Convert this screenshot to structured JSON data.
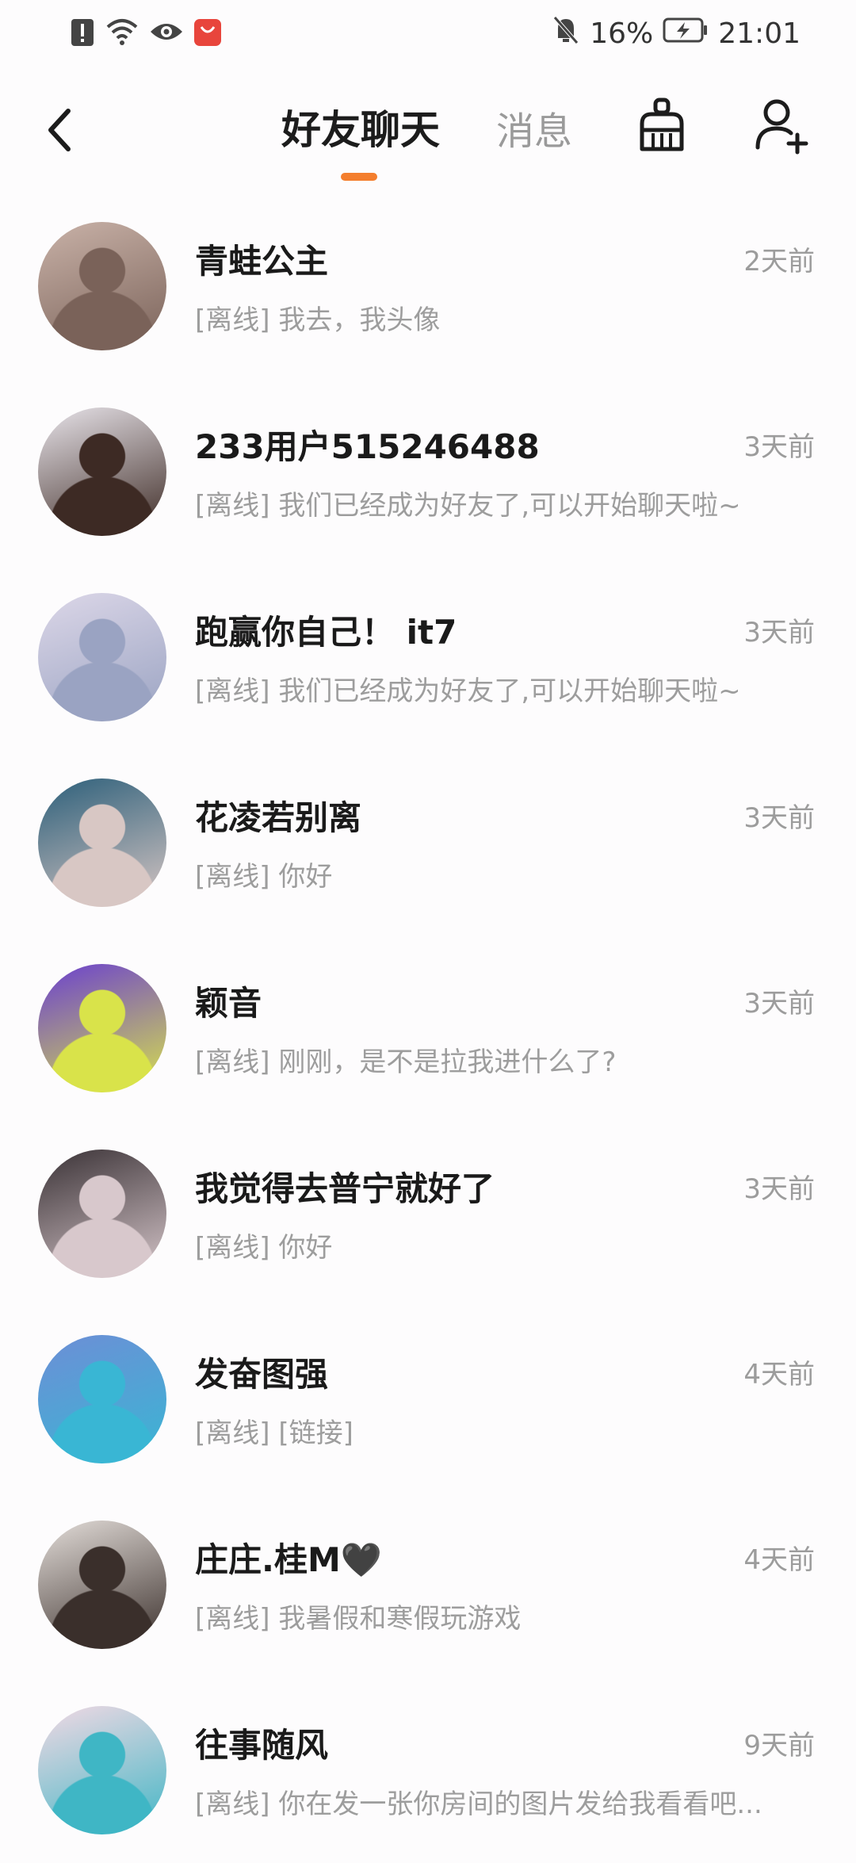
{
  "status_bar": {
    "battery": "16%",
    "time": "21:01",
    "icons": [
      "alert-icon",
      "wifi-icon",
      "eye-icon",
      "app-notification-icon",
      "mute-bell-icon",
      "battery-charging-icon"
    ]
  },
  "header": {
    "tab_friends": "好友聊天",
    "tab_messages": "消息",
    "accent_color": "#f47e2d",
    "icons": [
      "back-arrow-icon",
      "clean-broom-icon",
      "add-friend-icon"
    ]
  },
  "chats": [
    {
      "name": "青蛙公主",
      "time": "2天前",
      "preview": "[离线] 我去，我头像",
      "avatar_colors": [
        "#c9b2a8",
        "#7a6259"
      ]
    },
    {
      "name": "233用户515246488",
      "time": "3天前",
      "preview": "[离线] 我们已经成为好友了,可以开始聊天啦~",
      "avatar_colors": [
        "#e8e4ea",
        "#3d2a24"
      ]
    },
    {
      "name": "跑赢你自己！ it7",
      "time": "3天前",
      "preview": "[离线] 我们已经成为好友了,可以开始聊天啦~",
      "avatar_colors": [
        "#dcd7e8",
        "#9aa3c2"
      ]
    },
    {
      "name": "花凌若别离",
      "time": "3天前",
      "preview": "[离线] 你好",
      "avatar_colors": [
        "#2c5f7a",
        "#d8c7c4"
      ]
    },
    {
      "name": "颖音",
      "time": "3天前",
      "preview": "[离线] 刚刚，是不是拉我进什么了?",
      "avatar_colors": [
        "#6a3fd0",
        "#d9e34a"
      ]
    },
    {
      "name": "我觉得去普宁就好了",
      "time": "3天前",
      "preview": "[离线] 你好",
      "avatar_colors": [
        "#3a3236",
        "#d8c8cc"
      ]
    },
    {
      "name": "发奋图强",
      "time": "4天前",
      "preview": "[离线] [链接]",
      "avatar_colors": [
        "#6d8ed6",
        "#39b6d4"
      ]
    },
    {
      "name": "庄庄.桂M🖤",
      "time": "4天前",
      "preview": "[离线] 我暑假和寒假玩游戏",
      "avatar_colors": [
        "#e3ddd9",
        "#3a2f2b"
      ]
    },
    {
      "name": "往事随风",
      "time": "9天前",
      "preview": "[离线] 你在发一张你房间的图片发给我看看吧...",
      "avatar_colors": [
        "#f2d9e4",
        "#3fb6c5"
      ]
    }
  ]
}
